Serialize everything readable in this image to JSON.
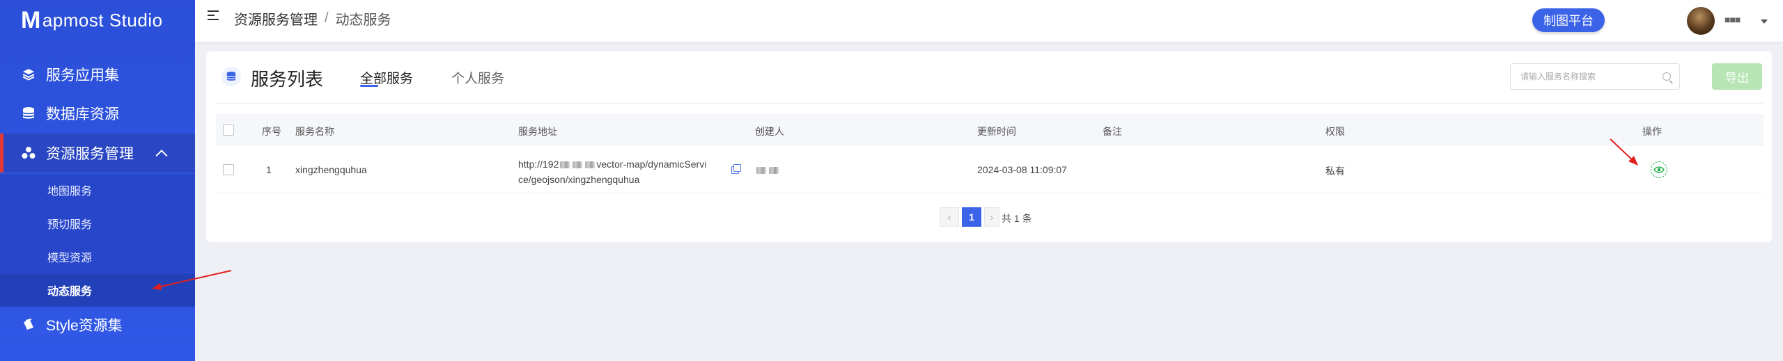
{
  "app": {
    "logo_letter": "M",
    "logo_rest": "apmost Studio"
  },
  "sidebar": {
    "items": [
      {
        "label": "服务应用集",
        "icon": "layers-icon"
      },
      {
        "label": "数据库资源",
        "icon": "database-icon"
      },
      {
        "label": "资源服务管理",
        "icon": "cluster-icon"
      },
      {
        "label": "Style资源集",
        "icon": "style-icon"
      }
    ],
    "sub_items": [
      {
        "label": "地图服务"
      },
      {
        "label": "预切服务"
      },
      {
        "label": "模型资源"
      },
      {
        "label": "动态服务"
      }
    ]
  },
  "header": {
    "breadcrumb_parent": "资源服务管理",
    "breadcrumb_sep": "/",
    "breadcrumb_current": "动态服务",
    "platform_button": "制图平台",
    "username": "■■■",
    "colors": {
      "accent": "#3a63e8",
      "sidebar": "#2b4fd8"
    }
  },
  "card": {
    "title": "服务列表",
    "tabs": [
      {
        "label": "全部服务"
      },
      {
        "label": "个人服务"
      }
    ],
    "search_placeholder": "请输入服务名称搜索",
    "export_label": "导出",
    "export_color": "#b7e5b3"
  },
  "table": {
    "headers": {
      "index": "序号",
      "name": "服务名称",
      "url": "服务地址",
      "creator": "创建人",
      "updated": "更新时间",
      "note": "备注",
      "perm": "权限",
      "action": "操作"
    },
    "rows": [
      {
        "index": "1",
        "name": "xingzhengquhua",
        "url_line1_start": "http://192",
        "url_line1_end": "vector-map/dynamicServi",
        "url_line2": "ce/geojson/xingzhengquhua",
        "updated": "2024-03-08 11:09:07",
        "note": "",
        "perm": "私有",
        "action_icon": "eye-icon"
      }
    ]
  },
  "pagination": {
    "current": "1",
    "total": "共 1 条"
  }
}
